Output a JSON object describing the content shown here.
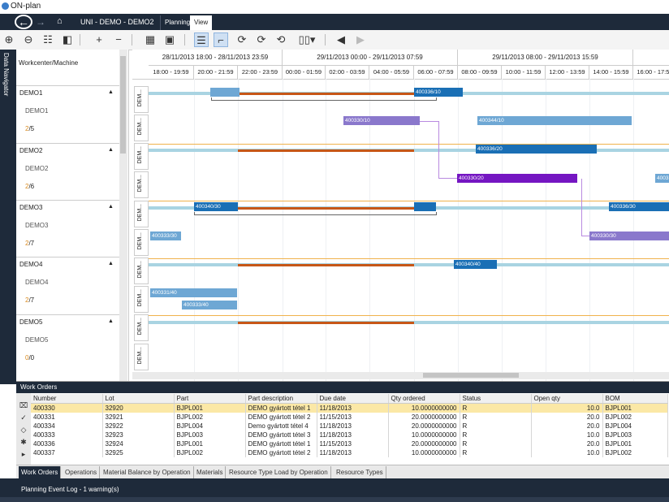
{
  "window": {
    "title": "ON-plan"
  },
  "nav": {
    "breadcrumb": "UNI - DEMO - DEMO2",
    "tabs": [
      "Planning",
      "View"
    ],
    "active_tab": "View"
  },
  "rail": {
    "label": "Data Navigator"
  },
  "workcenters": {
    "header": "Workcenter/Machine",
    "groups": [
      {
        "name": "DEMO1",
        "machine": "DEMO1",
        "count_a": "2",
        "count_b": "/5"
      },
      {
        "name": "DEMO2",
        "machine": "DEMO2",
        "count_a": "2",
        "count_b": "/6"
      },
      {
        "name": "DEMO3",
        "machine": "DEMO3",
        "count_a": "2",
        "count_b": "/7"
      },
      {
        "name": "DEMO4",
        "machine": "DEMO4",
        "count_a": "2",
        "count_b": "/7"
      },
      {
        "name": "DEMO5",
        "machine": "DEMO5",
        "count_a": "0",
        "count_b": "/0"
      }
    ]
  },
  "gantt": {
    "periods": [
      "28/11/2013 18:00 - 28/11/2013 23:59",
      "29/11/2013 00:00 - 29/11/2013 07:59",
      "29/11/2013 08:00 - 29/11/2013 15:59"
    ],
    "hours": [
      "18:00 - 19:59",
      "20:00 - 21:59",
      "22:00 - 23:59",
      "00:00 - 01:59",
      "02:00 - 03:59",
      "04:00 - 05:59",
      "06:00 - 07:59",
      "08:00 - 09:59",
      "10:00 - 11:59",
      "12:00 - 13:59",
      "14:00 - 15:59",
      "16:00 - 17:59"
    ],
    "row_labels": [
      "DEM...",
      "DEM...",
      "DEM...",
      "DEM...",
      "DEM...",
      "DEM...",
      "DEM...",
      "DEM...",
      "DEM...",
      "DEM..."
    ],
    "bars": {
      "b1": "400336/10",
      "b2": "400330/10",
      "b3": "400344/10",
      "b4": "400336/20",
      "b5": "400330/20",
      "b6": "400340/30",
      "b7": "400336/30",
      "b8": "400333/30",
      "b9": "400330/30",
      "b10": "400340/40",
      "b11": "400331/40",
      "b12": "400333/40",
      "b13": "4003"
    }
  },
  "work_orders": {
    "title": "Work Orders",
    "columns": [
      "Number",
      "Lot",
      "Part",
      "Part description",
      "Due date",
      "Qty ordered",
      "Status",
      "Open qty",
      "BOM"
    ],
    "rows": [
      [
        "400330",
        "32920",
        "BJPL001",
        "DEMO gyártott tétel 1",
        "11/18/2013",
        "10.0000000000",
        "R",
        "10.0",
        "BJPL001"
      ],
      [
        "400331",
        "32921",
        "BJPL002",
        "DEMO gyártott tétel 2",
        "11/15/2013",
        "20.0000000000",
        "R",
        "20.0",
        "BJPL002"
      ],
      [
        "400334",
        "32922",
        "BJPL004",
        "Demo gyártott tétel 4",
        "11/18/2013",
        "20.0000000000",
        "R",
        "20.0",
        "BJPL004"
      ],
      [
        "400333",
        "32923",
        "BJPL003",
        "DEMO gyártott tétel 3",
        "11/18/2013",
        "10.0000000000",
        "R",
        "10.0",
        "BJPL003"
      ],
      [
        "400336",
        "32924",
        "BJPL001",
        "DEMO gyártott tétel 1",
        "11/15/2013",
        "20.0000000000",
        "R",
        "20.0",
        "BJPL001"
      ],
      [
        "400337",
        "32925",
        "BJPL002",
        "DEMO gyártott tétel 2",
        "11/18/2013",
        "10.0000000000",
        "R",
        "10.0",
        "BJPL002"
      ]
    ]
  },
  "bottom_tabs": [
    "Work Orders",
    "Operations",
    "Material Balance by Operation",
    "Materials",
    "Resource Type Load by Operation",
    "Resource Types"
  ],
  "status": {
    "text": "Planning Event Log - 1 warning(s)"
  }
}
